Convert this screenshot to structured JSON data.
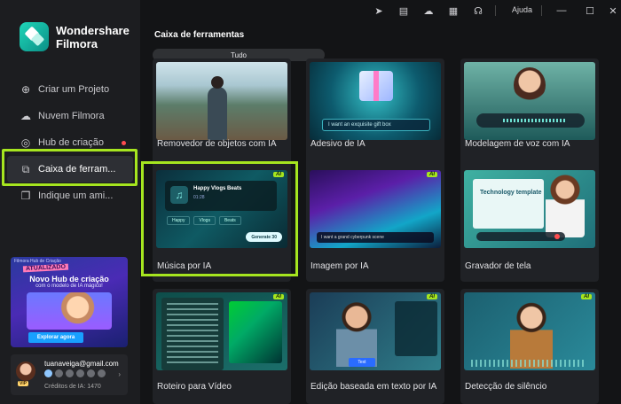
{
  "app": {
    "name_line1": "Wondershare",
    "name_line2": "Filmora"
  },
  "sidebar": {
    "items": [
      {
        "label": "Criar um Projeto",
        "icon": "plus-circle-icon"
      },
      {
        "label": "Nuvem Filmora",
        "icon": "cloud-icon"
      },
      {
        "label": "Hub de criação",
        "icon": "lightbulb-icon"
      },
      {
        "label": "Caixa de ferram...",
        "icon": "toolbox-icon"
      },
      {
        "label": "Indique um ami...",
        "icon": "gift-icon"
      }
    ],
    "promo": {
      "top": "Filmora Hub de Criação",
      "badge": "ATUALIZADO",
      "title": "Novo Hub de criação",
      "subtitle": "com o modelo de IA mágico!",
      "button": "Explorar agora"
    },
    "account": {
      "email": "tuanaveiga@gmail.com",
      "credits": "Créditos de IA: 1470",
      "badge": "VIP"
    }
  },
  "topbar": {
    "help": "Ajuda"
  },
  "main": {
    "title": "Caixa de ferramentas",
    "tab": "Tudo",
    "ai_badge": "AI",
    "cards": [
      {
        "label": "Removedor de objetos com IA"
      },
      {
        "label": "Adesivo de IA",
        "bubble": "I want an exquisite gift box"
      },
      {
        "label": "Modelagem de voz com IA"
      },
      {
        "label": "Música por IA",
        "player_title": "Happy Vlogs Beats",
        "player_time": "01:28",
        "chips": [
          "Happy",
          "Vlogs",
          "Beats"
        ],
        "generate": "Generate  30"
      },
      {
        "label": "Imagem por IA",
        "prompt": "I want a grand cyberpunk scene"
      },
      {
        "label": "Gravador de tela",
        "slide_text": "Technology template"
      },
      {
        "label": "Roteiro para Vídeo"
      },
      {
        "label": "Edição baseada em texto por IA",
        "button": "Text"
      },
      {
        "label": "Detecção de silêncio"
      }
    ]
  },
  "colors": {
    "accent": "#a6e51f",
    "background": "#131416",
    "sidebar": "#1c1d20"
  }
}
